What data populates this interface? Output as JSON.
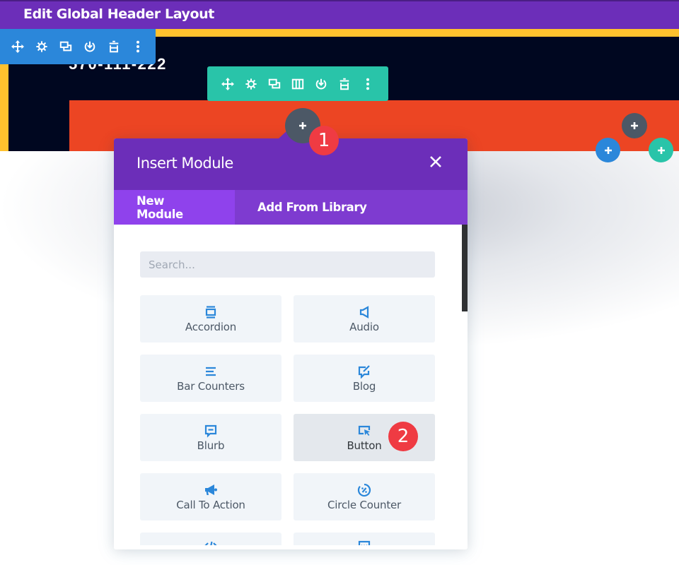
{
  "top_bar": {
    "title": "Edit Global Header Layout"
  },
  "header_preview": {
    "phone_text": "570-111-222"
  },
  "colors": {
    "top_bar": "#6c2eb9",
    "yellow_band": "#ffc12e",
    "dark_section": "#000720",
    "orange_row": "#ec4523",
    "section_toolbar": "#2b87da",
    "row_toolbar": "#29c4a9",
    "module_add": "#4c5866",
    "badge": "#ef3b43",
    "modal_header": "#6c2eb9",
    "modal_tab_active": "#8f42ec",
    "icon_accent": "#2b87da"
  },
  "section_toolbar": {
    "buttons": [
      {
        "icon": "move-icon",
        "label": "Move"
      },
      {
        "icon": "gear-icon",
        "label": "Settings"
      },
      {
        "icon": "duplicate-icon",
        "label": "Duplicate"
      },
      {
        "icon": "save-to-library-icon",
        "label": "Save to Library"
      },
      {
        "icon": "trash-icon",
        "label": "Delete"
      },
      {
        "icon": "more-icon",
        "label": "More"
      }
    ]
  },
  "row_toolbar": {
    "buttons": [
      {
        "icon": "move-icon",
        "label": "Move"
      },
      {
        "icon": "gear-icon",
        "label": "Settings"
      },
      {
        "icon": "duplicate-icon",
        "label": "Duplicate"
      },
      {
        "icon": "columns-icon",
        "label": "Change Column Structure"
      },
      {
        "icon": "save-to-library-icon",
        "label": "Save to Library"
      },
      {
        "icon": "trash-icon",
        "label": "Delete"
      },
      {
        "icon": "more-icon",
        "label": "More"
      }
    ]
  },
  "badges": {
    "step1": "1",
    "step2": "2"
  },
  "modal": {
    "title": "Insert Module",
    "tabs": [
      {
        "label": "New Module",
        "active": true
      },
      {
        "label": "Add From Library",
        "active": false
      }
    ],
    "search": {
      "placeholder": "Search...",
      "value": ""
    },
    "modules": [
      {
        "label": "Accordion",
        "icon": "accordion-icon"
      },
      {
        "label": "Audio",
        "icon": "audio-icon"
      },
      {
        "label": "Bar Counters",
        "icon": "bar-counters-icon"
      },
      {
        "label": "Blog",
        "icon": "blog-icon"
      },
      {
        "label": "Blurb",
        "icon": "blurb-icon"
      },
      {
        "label": "Button",
        "icon": "button-icon",
        "hovered": true
      },
      {
        "label": "Call To Action",
        "icon": "call-to-action-icon"
      },
      {
        "label": "Circle Counter",
        "icon": "circle-counter-icon"
      },
      {
        "label": "",
        "icon": "code-icon"
      },
      {
        "label": "",
        "icon": "comments-icon"
      }
    ]
  }
}
